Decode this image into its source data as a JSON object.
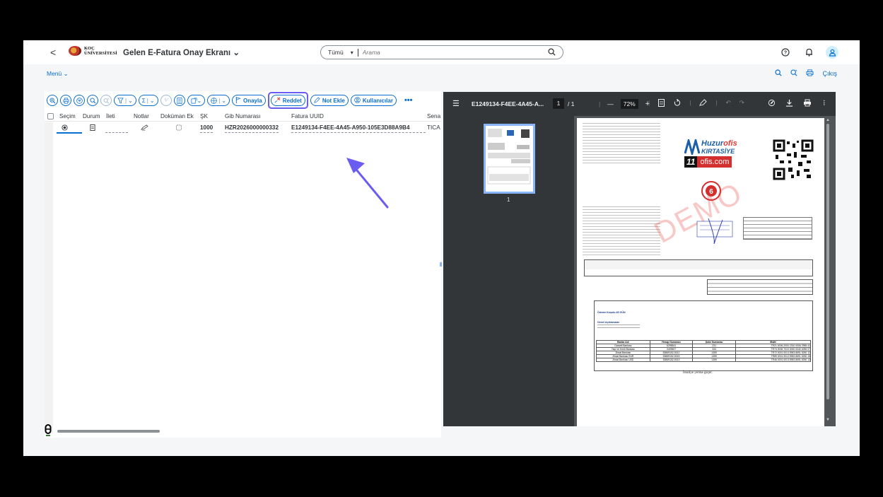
{
  "shell": {
    "back": "<",
    "logo_text_1": "KOÇ",
    "logo_text_2": "ÜNİVERSİTESİ",
    "app_title": "Gelen E-Fatura Onay Ekranı",
    "title_chevron": "⌄",
    "search_scope": "Tümü",
    "search_placeholder": "Arama",
    "help_icon": "?",
    "bell_icon": "🔔︎",
    "avatar_icon": "👤︎"
  },
  "subheader": {
    "menu_label": "Menü",
    "icons": [
      "search-icon",
      "filter-icon",
      "print-icon"
    ],
    "logout_label": "Çıkış"
  },
  "toolbar": {
    "onayla_label": "Onayla",
    "reddet_label": "Reddet",
    "not_ekle_label": "Not Ekle",
    "kullanicilar_label": "Kullanıcılar",
    "more_label": "•••"
  },
  "grid": {
    "columns": [
      "Seçim",
      "Durum",
      "İleti",
      "Notlar",
      "Doküman Ek",
      "ŞK",
      "Gib Numarası",
      "Fatura UUID",
      "Sena"
    ],
    "rows": [
      {
        "sk": "1000",
        "gib_numarasi": "HZR2026000000332",
        "fatura_uuid": "E1249134-F4EE-4A45-A950-105E3D88A9B4",
        "sena": "TICA"
      }
    ]
  },
  "pdf": {
    "filename": "E1249134-F4EE-4A45-A...",
    "page_current": "1",
    "page_total": "/ 1",
    "zoom_minus": "—",
    "zoom_value": "72%",
    "zoom_plus": "+",
    "thumb_page": "1",
    "invoice": {
      "brand_1": "Huzur",
      "brand_2": "ofis",
      "brand_3": "KIRTASİYE",
      "ofis_num": "11",
      "ofis_com": "ofis.com",
      "watermark": "DEMO",
      "odeme_label": "Ödeme Koşulu:45 GÜN",
      "genel_label": "Genel Açıklamalar",
      "bank_header": [
        "Banka Adı",
        "Hesap Numarası",
        "Şube Numarası",
        "IBAN"
      ],
      "banks": [
        [
          "Garanti Bankası",
          "6295541",
          "231",
          "TR21 0006 2000 2310 0006 2955 41"
        ],
        [
          "Yapı ve Kredi Bankası",
          "0409607",
          "334",
          "TR74 0006 7010 0000 0040 4096 07"
        ],
        [
          "Ziraat Bankası",
          "53869152-5012",
          "1359",
          "TR72 0001 0013 5953 8691 5250 12"
        ],
        [
          "Ziraat Bankası EUR",
          "53869152-5015",
          "1359",
          "TR89 0001 0013 5953 8691 5250 15"
        ],
        [
          "Ziraat Bankası USD",
          "53869152-5013",
          "1359",
          "TR46 0001 0013 5953 8691 5250 13"
        ]
      ],
      "irsaliye": "İrsaliye yerine geçer."
    }
  },
  "colors": {
    "accent": "#0a6ed1",
    "highlight": "#6a5cf0",
    "reject": "#e53935"
  }
}
